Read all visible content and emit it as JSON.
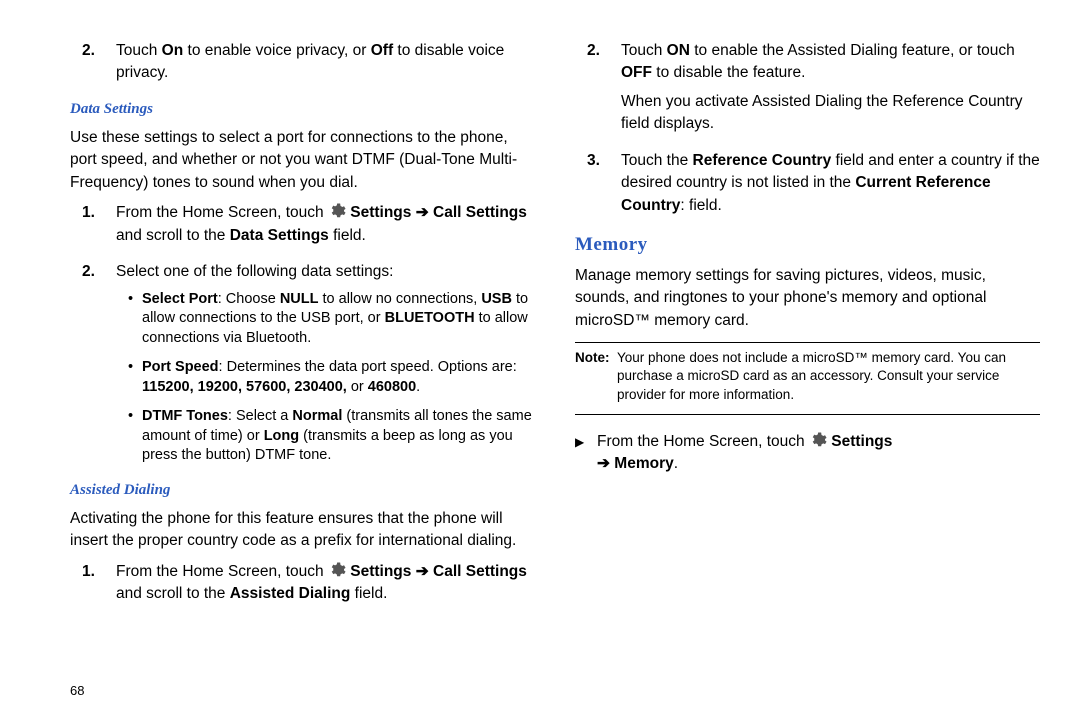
{
  "page_number": "68",
  "left": {
    "step2_voice": {
      "pre": "Touch ",
      "bold1": "On",
      "mid1": " to enable voice privacy, or ",
      "bold2": "Off",
      "post": " to disable voice privacy."
    },
    "data_settings_heading": "Data Settings",
    "data_settings_intro": "Use these settings to select a port for connections to the phone, port speed, and whether or not you want DTMF (Dual-Tone Multi-Frequency) tones to sound when you dial.",
    "ds_step1": {
      "pre": "From the Home Screen, touch ",
      "settings": "Settings",
      "arrow": " ➔ ",
      "call_settings": "Call Settings",
      "mid": " and scroll to the ",
      "ds_field": "Data Settings",
      "post": " field."
    },
    "ds_step2_intro": "Select one of the following data settings:",
    "bullet_select_port": {
      "label": "Select Port",
      "pre": ": Choose ",
      "null": "NULL",
      "mid1": " to allow no connections, ",
      "usb": "USB",
      "mid2": " to allow connections to the USB port, or ",
      "bt": "BLUETOOTH",
      "post": " to allow connections via Bluetooth."
    },
    "bullet_port_speed": {
      "label": "Port Speed",
      "body": ": Determines the data port speed. Options are: ",
      "opts": "115200, 19200, 57600, 230400,",
      "or": " or ",
      "last": "460800",
      "end": "."
    },
    "bullet_dtmf": {
      "label": "DTMF Tones",
      "pre": ": Select a ",
      "normal": "Normal",
      "mid": " (transmits all tones the same amount of time) or ",
      "long": "Long",
      "post": " (transmits a beep as long as you press the button) DTMF tone."
    },
    "assisted_heading": "Assisted Dialing",
    "assisted_intro": "Activating the phone for this feature ensures that the phone will insert the proper country code as a prefix for international dialing.",
    "ad_step1": {
      "pre": "From the Home Screen, touch ",
      "settings": "Settings",
      "arrow": " ➔ ",
      "call_settings": "Call Settings",
      "mid": " and scroll to the ",
      "ad_field": "Assisted Dialing",
      "post": " field."
    }
  },
  "right": {
    "ad_step2": {
      "pre": "Touch ",
      "on": "ON",
      "mid1": " to enable the Assisted Dialing feature, or touch ",
      "off": "OFF",
      "mid2": " to disable the feature.",
      "line2": "When you activate Assisted Dialing the Reference Country field displays."
    },
    "ad_step3": {
      "pre": "Touch the ",
      "rc": "Reference Country",
      "mid1": " field and enter a country if the desired country is not listed in the ",
      "crc": "Current Reference Country",
      "end": ": field."
    },
    "memory_heading": "Memory",
    "memory_intro": "Manage memory settings for saving pictures, videos, music, sounds, and ringtones to your phone's memory and optional microSD™ memory card.",
    "note_label": "Note:",
    "note_body": " Your phone does not include a microSD™ memory card. You can purchase a microSD card as an accessory. Consult your service provider for more information.",
    "mem_step": {
      "pre": "From the Home Screen, touch ",
      "settings": "Settings",
      "arrow": " ➔ ",
      "memory": "Memory",
      "post": "."
    }
  }
}
